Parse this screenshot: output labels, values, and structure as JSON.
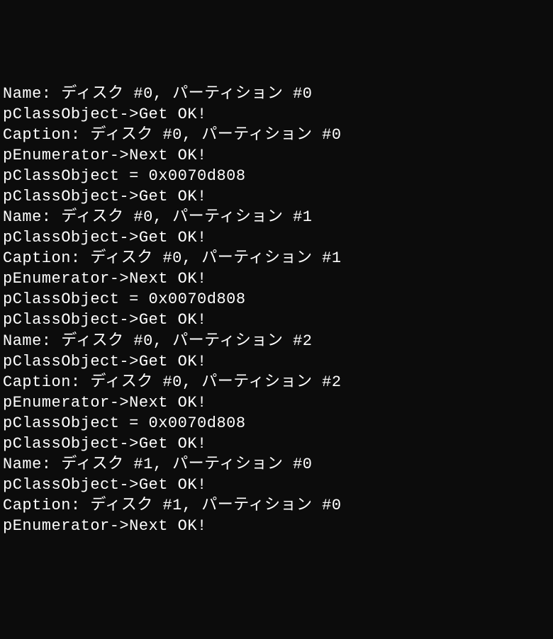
{
  "terminal": {
    "lines": [
      "Name: ディスク #0, パーティション #0",
      "pClassObject->Get OK!",
      "Caption: ディスク #0, パーティション #0",
      "pEnumerator->Next OK!",
      "pClassObject = 0x0070d808",
      "pClassObject->Get OK!",
      "Name: ディスク #0, パーティション #1",
      "pClassObject->Get OK!",
      "Caption: ディスク #0, パーティション #1",
      "pEnumerator->Next OK!",
      "pClassObject = 0x0070d808",
      "pClassObject->Get OK!",
      "Name: ディスク #0, パーティション #2",
      "pClassObject->Get OK!",
      "Caption: ディスク #0, パーティション #2",
      "pEnumerator->Next OK!",
      "pClassObject = 0x0070d808",
      "pClassObject->Get OK!",
      "Name: ディスク #1, パーティション #0",
      "pClassObject->Get OK!",
      "Caption: ディスク #1, パーティション #0",
      "pEnumerator->Next OK!"
    ]
  }
}
